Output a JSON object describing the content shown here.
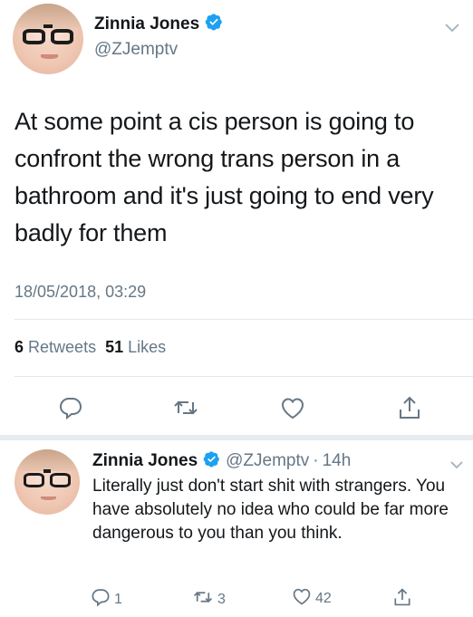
{
  "main_tweet": {
    "display_name": "Zinnia Jones",
    "handle": "@ZJemptv",
    "text": "At some point a cis person is going to confront the wrong trans person in a bathroom and it's just going to end very badly for them",
    "timestamp": "18/05/2018, 03:29",
    "retweets_count": "6",
    "retweets_label": "Retweets",
    "likes_count": "51",
    "likes_label": "Likes"
  },
  "reply_tweet": {
    "display_name": "Zinnia Jones",
    "handle": "@ZJemptv",
    "separator": "·",
    "time_ago": "14h",
    "text": "Literally just don't start shit with strangers. You have absolutely no idea who could be far more dangerous to you than you think.",
    "reply_count": "1",
    "retweet_count": "3",
    "like_count": "42"
  },
  "colors": {
    "verified": "#1da1f2",
    "secondary_text": "#657786",
    "primary_text": "#14171a",
    "divider": "#e1e8ed"
  },
  "icons": [
    "verified-badge-icon",
    "chevron-down-icon",
    "reply-icon",
    "retweet-icon",
    "like-icon",
    "share-icon"
  ]
}
